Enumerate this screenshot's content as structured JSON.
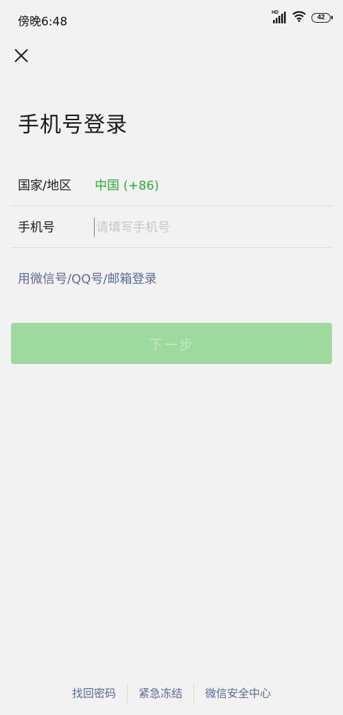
{
  "status_bar": {
    "time": "傍晚6:48",
    "network_label": "HD",
    "battery_level": "42",
    "icons": [
      "hd-signal-icon",
      "wifi-icon",
      "battery-icon"
    ]
  },
  "header": {
    "close_icon": "close-icon"
  },
  "page": {
    "title": "手机号登录"
  },
  "form": {
    "country": {
      "label": "国家/地区",
      "value": "中国 (+86)"
    },
    "phone": {
      "label": "手机号",
      "value": "",
      "placeholder": "请填写手机号"
    }
  },
  "alt_login": {
    "label": "用微信号/QQ号/邮箱登录"
  },
  "next_button": {
    "label": "下一步"
  },
  "footer": {
    "links": [
      "找回密码",
      "紧急冻结",
      "微信安全中心"
    ]
  },
  "colors": {
    "background": "#f2f2f2",
    "accent_green": "#2aae33",
    "link_blue": "#576b95",
    "button_disabled": "#9ed99e",
    "button_text_disabled": "#c4e8c4",
    "divider": "#dcdcdc"
  }
}
